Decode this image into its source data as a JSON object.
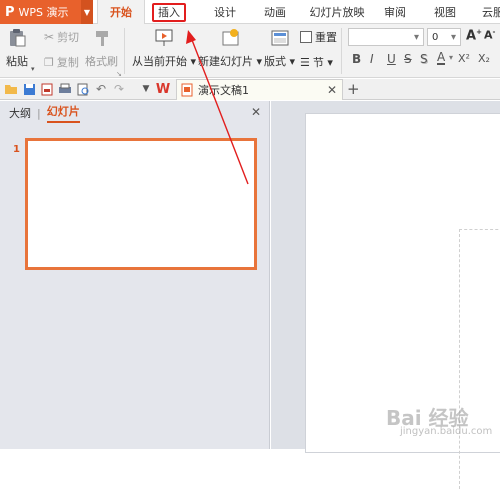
{
  "app": {
    "logo": "P",
    "name": "WPS 演示"
  },
  "tabs": [
    "开始",
    "插入",
    "设计",
    "动画",
    "幻灯片放映",
    "审阅",
    "视图",
    "云服"
  ],
  "ribbon": {
    "paste": "粘贴",
    "cut": "剪切",
    "copy": "复制",
    "format_painter": "格式刷",
    "from_current": "从当前开始",
    "new_slide": "新建幻灯片",
    "layout": "版式",
    "reset": "重置",
    "section": "节",
    "font_size": "0",
    "bold": "B",
    "italic": "I",
    "underline": "U",
    "strike": "S",
    "shadow": "S",
    "font_color": "A",
    "superscript": "X²",
    "subscript": "X₂",
    "grow": "A",
    "shrink": "A"
  },
  "document": {
    "tab_title": "演示文稿1"
  },
  "panel": {
    "outline_tab": "大纲",
    "slides_tab": "幻灯片",
    "slide_number": "1"
  },
  "watermark": {
    "main": "Bai 经验",
    "sub": "jingyan.baidu.com"
  },
  "colors": {
    "accent": "#e8612c",
    "annotation": "#e21e1e"
  }
}
